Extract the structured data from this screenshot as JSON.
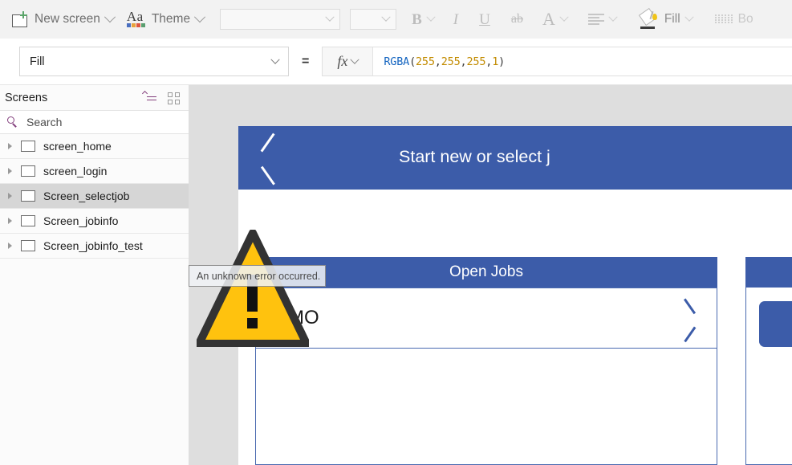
{
  "toolbar": {
    "new_screen": {
      "label": "New screen",
      "icon": "new-screen-icon"
    },
    "theme": {
      "label": "Theme",
      "icon": "theme-icon"
    },
    "font_family": {
      "value": "",
      "placeholder": ""
    },
    "font_size": {
      "value": "",
      "placeholder": ""
    },
    "bold": "B",
    "italic": "I",
    "underline": "U",
    "strikethrough": "ab",
    "font_color": "A",
    "align": "align-icon",
    "fill": {
      "label": "Fill",
      "icon": "fill-bucket-icon"
    },
    "border": {
      "label": "Bo",
      "icon": "border-icon"
    }
  },
  "formula_bar": {
    "property": "Fill",
    "equals": "=",
    "fx": "fx",
    "formula": {
      "fn": "RGBA",
      "open": "(",
      "r": "255",
      "c1": ",",
      "g": "255",
      "c2": ",",
      "b": "255",
      "c3": ",",
      "a": "1",
      "close": ")"
    }
  },
  "sidebar": {
    "title": "Screens",
    "tree_view_icon": "tree-view-icon",
    "grid_view_icon": "grid-view-icon",
    "search": {
      "placeholder": "Search",
      "value": ""
    },
    "items": [
      {
        "label": "screen_home",
        "selected": false
      },
      {
        "label": "screen_login",
        "selected": false
      },
      {
        "label": "Screen_selectjob",
        "selected": true
      },
      {
        "label": "Screen_jobinfo",
        "selected": false
      },
      {
        "label": "Screen_jobinfo_test",
        "selected": false
      }
    ]
  },
  "canvas": {
    "app_header_title": "Start new or select j",
    "back_icon": "back-chevron-icon",
    "gallery_open_jobs": {
      "header": "Open Jobs",
      "rows": [
        {
          "label": "b MO",
          "chevron": "forward-chevron-icon"
        },
        {
          "label": ""
        }
      ]
    },
    "panel_right": {
      "header": "",
      "button_label": ""
    }
  },
  "error": {
    "tooltip": "An unknown error occurred.",
    "icon": "warning-triangle-icon"
  },
  "colors": {
    "brand_blue": "#3c5ca9",
    "gallery_border": "#4a6ab0",
    "warning_yellow": "#FFC20E",
    "warning_outline": "#333333",
    "canvas_gray": "#dedede",
    "selected_row": "#d6d6d6",
    "accent_purple": "#833f7d"
  }
}
